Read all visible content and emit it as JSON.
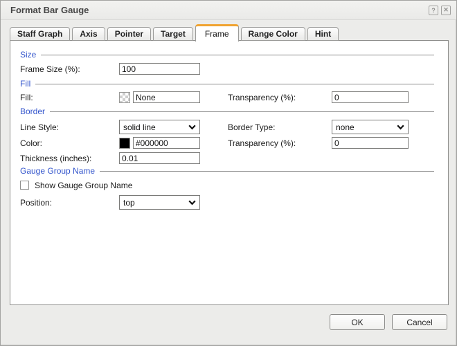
{
  "window": {
    "title": "Format Bar Gauge",
    "help": "?",
    "close": "✕"
  },
  "tabs": [
    {
      "label": "Staff Graph"
    },
    {
      "label": "Axis"
    },
    {
      "label": "Pointer"
    },
    {
      "label": "Target"
    },
    {
      "label": "Frame",
      "active": true
    },
    {
      "label": "Range Color"
    },
    {
      "label": "Hint"
    }
  ],
  "sections": {
    "size": {
      "header": "Size",
      "frame_size": {
        "label": "Frame Size (%):",
        "value": "100"
      }
    },
    "fill": {
      "header": "Fill",
      "fill": {
        "label": "Fill:",
        "value": "None",
        "swatch": "transparent-checker"
      },
      "transparency": {
        "label": "Transparency (%):",
        "value": "0"
      }
    },
    "border": {
      "header": "Border",
      "line_style": {
        "label": "Line Style:",
        "value": "solid line"
      },
      "border_type": {
        "label": "Border Type:",
        "value": "none"
      },
      "color": {
        "label": "Color:",
        "value": "#000000",
        "swatch": "#000000"
      },
      "transparency": {
        "label": "Transparency (%):",
        "value": "0"
      },
      "thickness": {
        "label": "Thickness (inches):",
        "value": "0.01"
      }
    },
    "gauge_group": {
      "header": "Gauge Group Name",
      "show_name": {
        "label": "Show Gauge Group Name",
        "checked": false
      },
      "position": {
        "label": "Position:",
        "value": "top"
      }
    }
  },
  "footer": {
    "ok": "OK",
    "cancel": "Cancel"
  },
  "colors": {
    "active_tab_accent": "#F0A330",
    "section_heading": "#3355CC"
  }
}
